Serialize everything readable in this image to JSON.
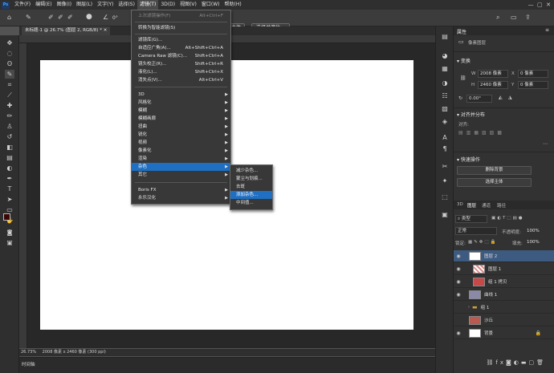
{
  "app": {
    "logo": "Ps"
  },
  "menubar": [
    "文件(F)",
    "编辑(E)",
    "图像(I)",
    "图层(L)",
    "文字(Y)",
    "选择(S)",
    "滤镜(T)",
    "3D(D)",
    "视图(V)",
    "窗口(W)",
    "帮助(H)"
  ],
  "options": {
    "angle": "0°",
    "btn_subject": "主体",
    "btn_select_mask": "选择并遮住..."
  },
  "document": {
    "tab_title": "未标题-1 @ 26.7% (图层 2, RGB/8) *"
  },
  "status": {
    "zoom": "26.73%",
    "info": "2008 像素 x 2460 像素 (300 ppi)"
  },
  "timeline": {
    "label": "时间轴"
  },
  "filter_menu": {
    "items": [
      {
        "label": "上次滤镜操作(F)",
        "shortcut": "Alt+Ctrl+F",
        "disabled": true
      },
      {
        "label": "转换为智能滤镜(S)"
      },
      {
        "label": "滤镜库(G)..."
      },
      {
        "label": "自适应广角(A)...",
        "shortcut": "Alt+Shift+Ctrl+A"
      },
      {
        "label": "Camera Raw 滤镜(C)...",
        "shortcut": "Shift+Ctrl+A"
      },
      {
        "label": "镜头校正(R)...",
        "shortcut": "Shift+Ctrl+R"
      },
      {
        "label": "液化(L)...",
        "shortcut": "Shift+Ctrl+X"
      },
      {
        "label": "消失点(V)...",
        "shortcut": "Alt+Ctrl+V"
      },
      {
        "label": "3D",
        "submenu": true
      },
      {
        "label": "风格化",
        "submenu": true
      },
      {
        "label": "模糊",
        "submenu": true
      },
      {
        "label": "模糊画廊",
        "submenu": true
      },
      {
        "label": "扭曲",
        "submenu": true
      },
      {
        "label": "锐化",
        "submenu": true
      },
      {
        "label": "视频",
        "submenu": true
      },
      {
        "label": "像素化",
        "submenu": true
      },
      {
        "label": "渲染",
        "submenu": true
      },
      {
        "label": "杂色",
        "submenu": true,
        "highlighted": true
      },
      {
        "label": "其它",
        "submenu": true
      },
      {
        "label": "Boris FX",
        "submenu": true
      },
      {
        "label": "永乐汉化",
        "submenu": true
      }
    ]
  },
  "noise_submenu": {
    "items": [
      {
        "label": "减少杂色..."
      },
      {
        "label": "蒙尘与划痕..."
      },
      {
        "label": "去斑"
      },
      {
        "label": "添加杂色...",
        "highlighted": true
      },
      {
        "label": "中间值..."
      }
    ]
  },
  "properties": {
    "tab": "属性",
    "kind": "像素图层",
    "transform_title": "变换",
    "w_label": "W",
    "w_value": "2008 像素",
    "x_label": "X",
    "x_value": "0 像素",
    "h_label": "H",
    "h_value": "2460 像素",
    "y_label": "Y",
    "y_value": "0 像素",
    "angle": "0.00°",
    "align_title": "对齐并分布",
    "align_sub": "对齐:",
    "quick_title": "快速操作",
    "btn_remove_bg": "删除背景",
    "btn_select_subject": "选择主体"
  },
  "layers_panel": {
    "tabs": [
      "3D",
      "图层",
      "通道",
      "路径"
    ],
    "kind_filter": "类型",
    "blend_mode": "正常",
    "opacity_label": "不透明度:",
    "opacity": "100%",
    "lock_label": "锁定:",
    "fill_label": "填充:",
    "fill": "100%",
    "layers": [
      {
        "name": "图层 2",
        "selected": true,
        "thumb": "#ffffff"
      },
      {
        "name": "图层 1",
        "thumb": "#c86a6a"
      },
      {
        "name": "组 1 拷贝",
        "thumb": "#c64848"
      },
      {
        "name": "曲线 1",
        "thumb": "#8a8aa8"
      },
      {
        "name": "组 1",
        "thumb": "#c8a040"
      },
      {
        "name": "沙丘",
        "thumb": "#b85a50"
      },
      {
        "name": "背景",
        "thumb": "#ffffff"
      }
    ]
  }
}
